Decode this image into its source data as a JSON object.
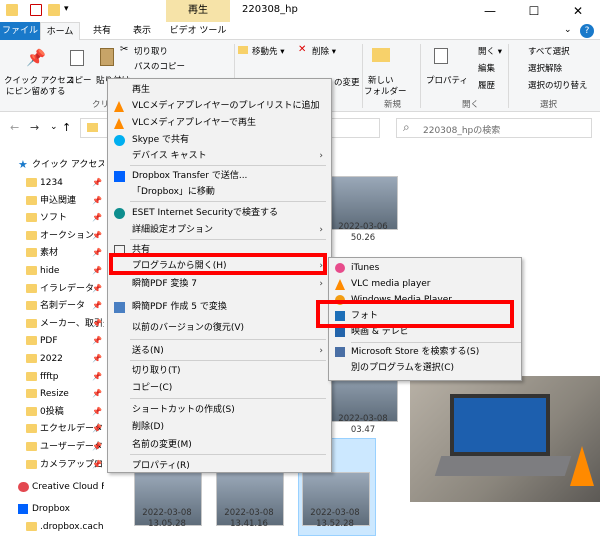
{
  "window": {
    "title": "220308_hp",
    "contextual_tab": "再生",
    "minimize": "—",
    "maximize": "☐",
    "close": "✕"
  },
  "ribbon_tabs": {
    "file": "ファイル",
    "home": "ホーム",
    "share": "共有",
    "view": "表示",
    "video_tools": "ビデオ ツール",
    "help": "?"
  },
  "ribbon": {
    "quick_access_1": "クイック アクセス",
    "quick_access_2": "にピン留めする",
    "copy": "コピー",
    "paste": "貼り付け",
    "cut": "切り取り",
    "copy_path": "パスのコピー",
    "clipboard_group": "クリ",
    "move_to": "移動先 ▾",
    "delete": "削除 ▾",
    "rename": "の変更",
    "new_folder_1": "新しい",
    "new_folder_2": "フォルダー",
    "new_group": "新規",
    "properties": "プロパティ",
    "open": "開く ▾",
    "edit": "編集",
    "history": "履歴",
    "open_group": "開く",
    "select_all": "すべて選択",
    "select_none": "選択解除",
    "invert_selection": "選択の切り替え",
    "select_group": "選択"
  },
  "address": {
    "back": "←",
    "forward": "→",
    "search_placeholder": "220308_hpの検索",
    "search_icon": "⌕"
  },
  "nav": {
    "quick_access": "クイック アクセス",
    "items": [
      "1234",
      "申込関連",
      "ソフト",
      "オークション",
      "素材",
      "hide",
      "イラレデータ",
      "名刺データ",
      "メーカー、取引先",
      "PDF",
      "2022",
      "ffftp",
      "Resize",
      "0投稿",
      "エクセルデータ",
      "ユーザーデータ",
      "カメラアップロード"
    ],
    "creative_cloud": "Creative Cloud Files",
    "dropbox": "Dropbox",
    "dropbox_cache": ".dropbox.cache"
  },
  "thumbnails": [
    {
      "date": "2022-03-06",
      "time": "50.26"
    },
    {
      "date": "2022-03-08",
      "time": "03.47"
    },
    {
      "date": "2022-03-08",
      "time": "13.05.28"
    },
    {
      "date": "2022-03-08",
      "time": "13.41.16"
    },
    {
      "date": "2022-03-08",
      "time": "13.52.28"
    }
  ],
  "context_menu": {
    "items": [
      {
        "label": "再生",
        "icon": "none",
        "arrow": ""
      },
      {
        "label": "VLCメディアプレイヤーのプレイリストに追加",
        "icon": "vlc-cone",
        "arrow": ""
      },
      {
        "label": "VLCメディアプレイヤーで再生",
        "icon": "vlc-cone",
        "arrow": ""
      },
      {
        "label": "Skype で共有",
        "icon": "skype",
        "arrow": ""
      },
      {
        "label": "デバイス キャスト",
        "icon": "none",
        "arrow": "›"
      },
      {
        "label": "Dropbox Transfer で送信...",
        "icon": "dropbox",
        "arrow": ""
      },
      {
        "label": "「Dropbox」に移動",
        "icon": "none",
        "arrow": ""
      },
      {
        "label": "ESET Internet Securityで検査する",
        "icon": "eset",
        "arrow": ""
      },
      {
        "label": "詳細設定オプション",
        "icon": "none",
        "arrow": "›"
      },
      {
        "label": "共有",
        "icon": "share",
        "arrow": ""
      },
      {
        "label": "プログラムから開く(H)",
        "icon": "none",
        "arrow": "›"
      },
      {
        "label": "瞬簡PDF 変換 7",
        "icon": "none",
        "arrow": "›"
      },
      {
        "label": "瞬簡PDF 作成 5 で変換",
        "icon": "pdf",
        "arrow": ""
      },
      {
        "label": "以前のバージョンの復元(V)",
        "icon": "none",
        "arrow": ""
      },
      {
        "label": "送る(N)",
        "icon": "none",
        "arrow": "›"
      },
      {
        "label": "切り取り(T)",
        "icon": "none",
        "arrow": ""
      },
      {
        "label": "コピー(C)",
        "icon": "none",
        "arrow": ""
      },
      {
        "label": "ショートカットの作成(S)",
        "icon": "none",
        "arrow": ""
      },
      {
        "label": "削除(D)",
        "icon": "none",
        "arrow": ""
      },
      {
        "label": "名前の変更(M)",
        "icon": "none",
        "arrow": ""
      },
      {
        "label": "プロパティ(R)",
        "icon": "none",
        "arrow": ""
      }
    ]
  },
  "submenu": {
    "items": [
      {
        "label": "iTunes",
        "icon": "itunes"
      },
      {
        "label": "VLC media player",
        "icon": "vlc-cone"
      },
      {
        "label": "Windows Media Player",
        "icon": "wmp"
      },
      {
        "label": "フォト",
        "icon": "photos"
      },
      {
        "label": "映画 & テレビ",
        "icon": "movies"
      },
      {
        "label": "Microsoft Store を検索する(S)",
        "icon": "store"
      },
      {
        "label": "別のプログラムを選択(C)",
        "icon": "none"
      }
    ]
  },
  "colors": {
    "file_tab": "#1979ca",
    "contextual_tab": "#f6e3a8",
    "highlight": "#ff0000",
    "menu_bg": "#f2f2f2",
    "vlc": "#ff8a00"
  }
}
